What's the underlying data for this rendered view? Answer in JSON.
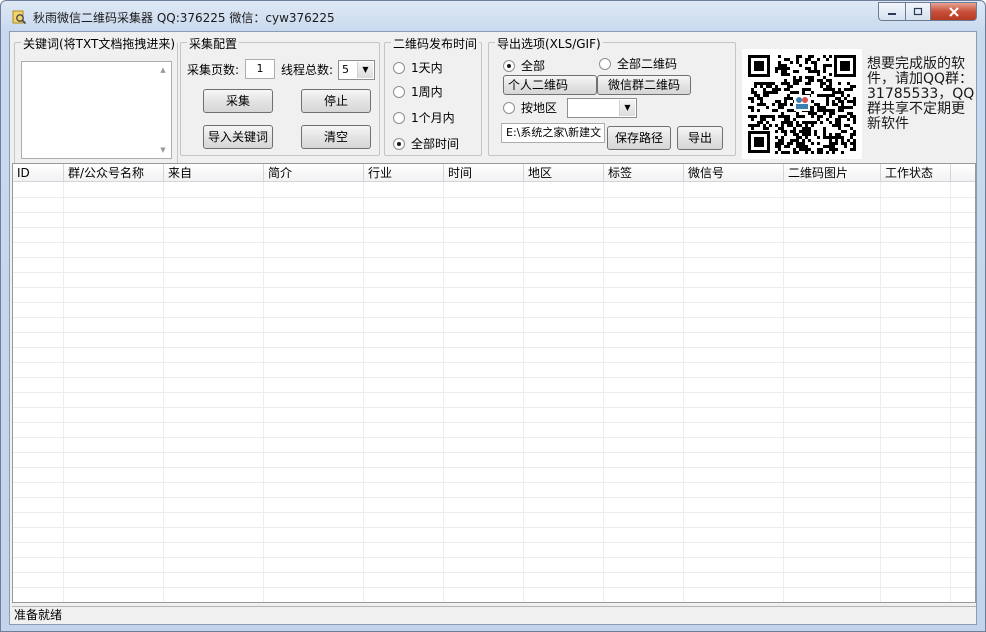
{
  "window": {
    "title": "秋雨微信二维码采集器 QQ:376225  微信：cyw376225"
  },
  "keywords_group": {
    "label": "关键词(将TXT文档拖拽进来)"
  },
  "collect_group": {
    "label": "采集配置",
    "pages_label": "采集页数:",
    "pages_value": "1",
    "threads_label": "线程总数:",
    "threads_value": "5",
    "collect_button": "采集",
    "stop_button": "停止",
    "import_button": "导入关键词",
    "clear_button": "清空"
  },
  "time_group": {
    "label": "二维码发布时间",
    "options": [
      "1天内",
      "1周内",
      "1个月内",
      "全部时间"
    ],
    "selected": "全部时间"
  },
  "export_group": {
    "label": "导出选项(XLS/GIF)",
    "radio_all": "全部",
    "radio_all_qr": "全部二维码",
    "personal_qr_button": "个人二维码",
    "group_qr_button": "微信群二维码",
    "radio_region": "按地区",
    "region_value": "",
    "path_value": "E:\\系统之家\\新建文",
    "save_path_button": "保存路径",
    "export_button": "导出"
  },
  "promo": {
    "text": "想要完成版的软件，请加QQ群：31785533，QQ群共享不定期更新软件"
  },
  "table": {
    "columns": [
      "ID",
      "群/公众号名称",
      "来自",
      "简介",
      "行业",
      "时间",
      "地区",
      "标签",
      "微信号",
      "二维码图片",
      "工作状态"
    ]
  },
  "status": {
    "text": "准备就绪"
  },
  "colors": {
    "accent": "#3c7fb1",
    "close_button": "#c7503a"
  }
}
